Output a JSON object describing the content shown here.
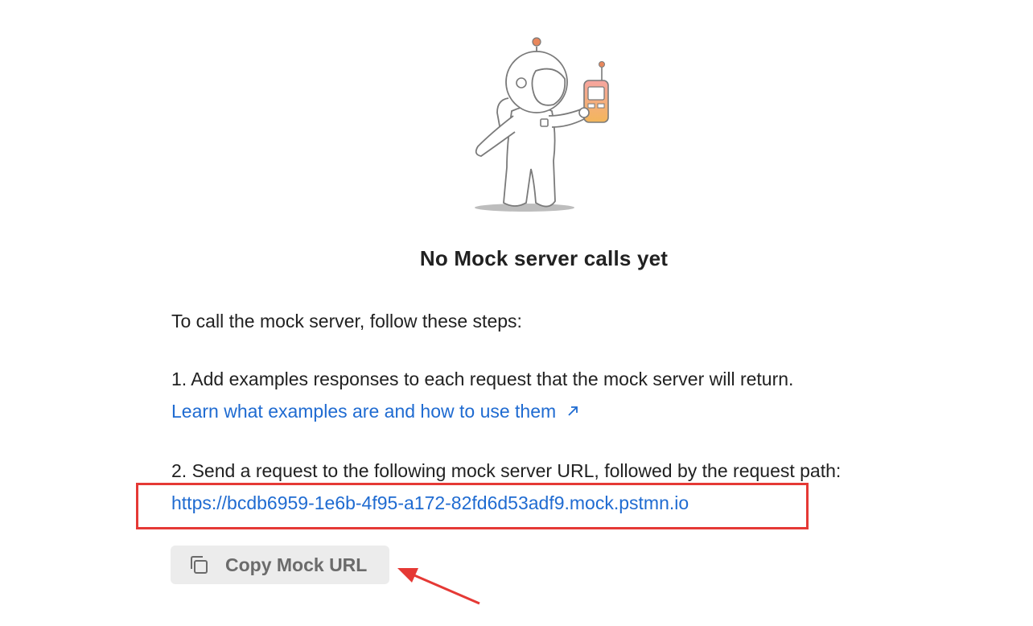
{
  "empty_state": {
    "title": "No Mock server calls yet",
    "intro": "To call the mock server, follow these steps:",
    "step1_text": "1. Add examples responses to each request that the mock server will return.",
    "step1_link": "Learn what examples are and how to use them",
    "step2_text": "2. Send a request to the following mock server URL, followed by the request path:",
    "mock_url": "https://bcdb6959-1e6b-4f95-a172-82fd6d53adf9.mock.pstmn.io",
    "copy_button_label": "Copy Mock URL"
  },
  "icons": {
    "illustration": "astronaut-with-walkie-talkie",
    "external_link": "arrow-up-right-icon",
    "copy": "copy-icon",
    "annotation": "red-arrow"
  },
  "colors": {
    "link": "#1f6bd1",
    "annotation_red": "#e53935",
    "button_bg": "#ececec",
    "accent_orange": "#e8875c"
  }
}
